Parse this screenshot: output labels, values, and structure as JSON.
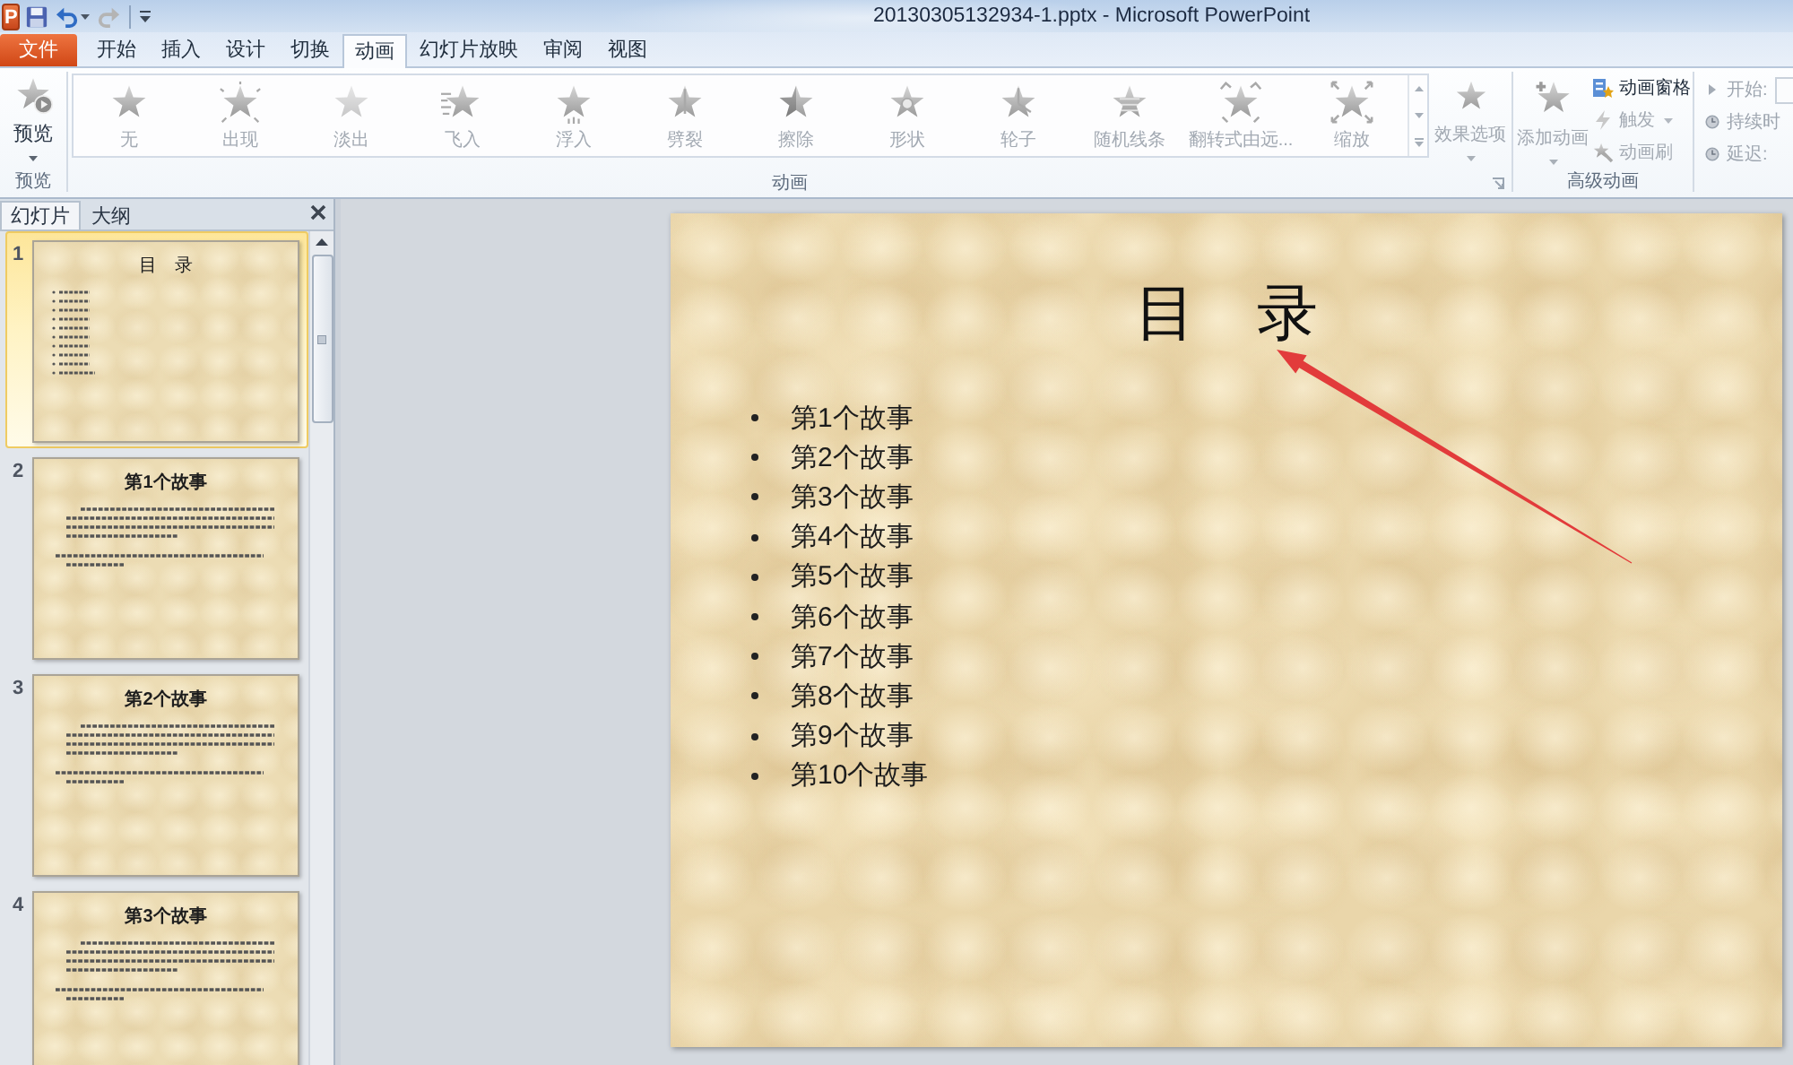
{
  "window": {
    "title": "20130305132934-1.pptx - Microsoft PowerPoint",
    "logo_letter": "P"
  },
  "quick_access": [
    {
      "kind": "save",
      "disabled": false
    },
    {
      "kind": "undo",
      "disabled": false
    },
    {
      "kind": "redo",
      "disabled": true
    }
  ],
  "file_tab": {
    "label": "文件"
  },
  "tabs": [
    {
      "label": "开始",
      "selected": false
    },
    {
      "label": "插入",
      "selected": false
    },
    {
      "label": "设计",
      "selected": false
    },
    {
      "label": "切换",
      "selected": false
    },
    {
      "label": "动画",
      "selected": true
    },
    {
      "label": "幻灯片放映",
      "selected": false
    },
    {
      "label": "审阅",
      "selected": false
    },
    {
      "label": "视图",
      "selected": false
    }
  ],
  "ribbon": {
    "preview_group": {
      "button": "预览",
      "label": "预览"
    },
    "animation_group": {
      "effects": [
        {
          "kind": "none",
          "label": "无",
          "disabled": true
        },
        {
          "kind": "appear",
          "label": "出现",
          "disabled": true
        },
        {
          "kind": "fade",
          "label": "淡出",
          "disabled": true
        },
        {
          "kind": "fly",
          "label": "飞入",
          "disabled": true
        },
        {
          "kind": "float",
          "label": "浮入",
          "disabled": true
        },
        {
          "kind": "split",
          "label": "劈裂",
          "disabled": true
        },
        {
          "kind": "wipe",
          "label": "擦除",
          "disabled": true
        },
        {
          "kind": "shape",
          "label": "形状",
          "disabled": true
        },
        {
          "kind": "wheel",
          "label": "轮子",
          "disabled": true
        },
        {
          "kind": "lines",
          "label": "随机线条",
          "disabled": true
        },
        {
          "kind": "turn",
          "label": "翻转式由远...",
          "disabled": true
        },
        {
          "kind": "zoom",
          "label": "缩放",
          "disabled": true
        }
      ],
      "effect_options": {
        "label": "效果选项",
        "disabled": true
      },
      "label": "动画"
    },
    "advanced_group": {
      "add_animation": {
        "label": "添加动画",
        "disabled": true
      },
      "commands": [
        {
          "kind": "pane",
          "label": "动画窗格",
          "disabled": false
        },
        {
          "kind": "trigger",
          "label": "触发",
          "disabled": true
        },
        {
          "kind": "painter",
          "label": "动画刷",
          "disabled": true
        }
      ],
      "label": "高级动画"
    },
    "timing_group": {
      "fields": [
        {
          "kind": "start",
          "label": "开始:",
          "disabled": true
        },
        {
          "kind": "duration",
          "label": "持续时",
          "disabled": true
        },
        {
          "kind": "delay",
          "label": "延迟:",
          "disabled": true
        }
      ]
    }
  },
  "slides_pane": {
    "tabs": [
      {
        "label": "幻灯片",
        "selected": true
      },
      {
        "label": "大纲",
        "selected": false
      }
    ],
    "slides": [
      {
        "number": "1",
        "kind": "list",
        "title": "目　录",
        "selected": true
      },
      {
        "number": "2",
        "kind": "text",
        "title": "第1个故事",
        "selected": false
      },
      {
        "number": "3",
        "kind": "text",
        "title": "第2个故事",
        "selected": false
      },
      {
        "number": "4",
        "kind": "text",
        "title": "第3个故事",
        "selected": false
      }
    ]
  },
  "slide": {
    "title": "目　录",
    "bullets": [
      "第1个故事",
      "第2个故事",
      "第3个故事",
      "第4个故事",
      "第5个故事",
      "第6个故事",
      "第7个故事",
      "第8个故事",
      "第9个故事",
      "第10个故事"
    ]
  }
}
